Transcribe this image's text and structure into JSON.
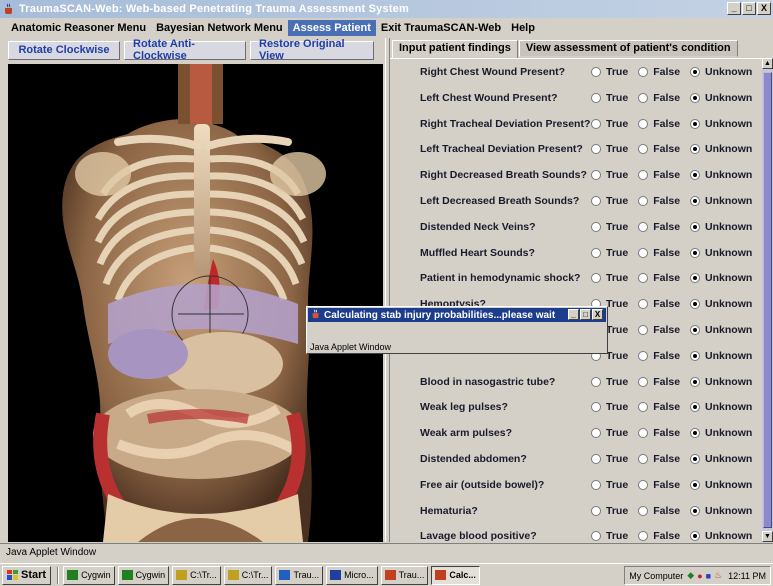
{
  "window": {
    "title": "TraumaSCAN-Web: Web-based Penetrating Trauma Assessment System",
    "controls": [
      "_",
      "□",
      "X"
    ]
  },
  "menu": {
    "items": [
      {
        "label": "Anatomic Reasoner Menu",
        "active": false
      },
      {
        "label": "Bayesian Network Menu",
        "active": false
      },
      {
        "label": "Assess Patient",
        "active": true
      },
      {
        "label": "Exit TraumaSCAN-Web",
        "active": false
      },
      {
        "label": "Help",
        "active": false
      }
    ]
  },
  "toolbar": {
    "rotate_cw": "Rotate Clockwise",
    "rotate_ccw": "Rotate Anti-Clockwise",
    "restore": "Restore Original View"
  },
  "tabs": [
    {
      "label": "Input patient findings",
      "selected": true
    },
    {
      "label": "View assessment of patient's condition",
      "selected": false
    }
  ],
  "options": {
    "true_label": "True",
    "false_label": "False",
    "unknown_label": "Unknown"
  },
  "findings": [
    {
      "label": "Right Chest Wound Present?",
      "value": "Unknown"
    },
    {
      "label": "Left Chest Wound Present?",
      "value": "Unknown"
    },
    {
      "label": "Right Tracheal Deviation Present?",
      "value": "Unknown"
    },
    {
      "label": "Left Tracheal Deviation Present?",
      "value": "Unknown"
    },
    {
      "label": "Right Decreased Breath Sounds?",
      "value": "Unknown"
    },
    {
      "label": "Left Decreased Breath Sounds?",
      "value": "Unknown"
    },
    {
      "label": "Distended Neck Veins?",
      "value": "Unknown"
    },
    {
      "label": "Muffled Heart Sounds?",
      "value": "Unknown"
    },
    {
      "label": "Patient in hemodynamic shock?",
      "value": "Unknown"
    },
    {
      "label": "Hemoptysis?",
      "value": "Unknown"
    },
    {
      "label": "",
      "value": "Unknown"
    },
    {
      "label": "",
      "value": "Unknown"
    },
    {
      "label": "Blood in nasogastric tube?",
      "value": "Unknown"
    },
    {
      "label": "Weak leg pulses?",
      "value": "Unknown"
    },
    {
      "label": "Weak arm pulses?",
      "value": "Unknown"
    },
    {
      "label": "Distended abdomen?",
      "value": "Unknown"
    },
    {
      "label": "Free air (outside bowel)?",
      "value": "Unknown"
    },
    {
      "label": "Hematuria?",
      "value": "Unknown"
    },
    {
      "label": "Lavage blood positive?",
      "value": "Unknown"
    }
  ],
  "dialog": {
    "title": "Calculating stab injury probabilities...please wait",
    "footer": "Java Applet Window"
  },
  "status": {
    "text": "Java Applet Window"
  },
  "taskbar": {
    "start": "Start",
    "items": [
      {
        "label": "Cygwin",
        "active": false
      },
      {
        "label": "Cygwin",
        "active": false
      },
      {
        "label": "C:\\Tr...",
        "active": false
      },
      {
        "label": "C:\\Tr...",
        "active": false
      },
      {
        "label": "Trau...",
        "active": false
      },
      {
        "label": "Micro...",
        "active": false
      },
      {
        "label": "Trau...",
        "active": false
      },
      {
        "label": "Calc...",
        "active": true
      }
    ],
    "mycomputer": "My Computer",
    "clock": "12:11 PM"
  },
  "colors": {
    "menu_active": "#4a6fb4",
    "dialog_title": "#1c3c8c",
    "button_text": "#1f3ea8",
    "scroll_thumb": "#8a8ac8"
  }
}
